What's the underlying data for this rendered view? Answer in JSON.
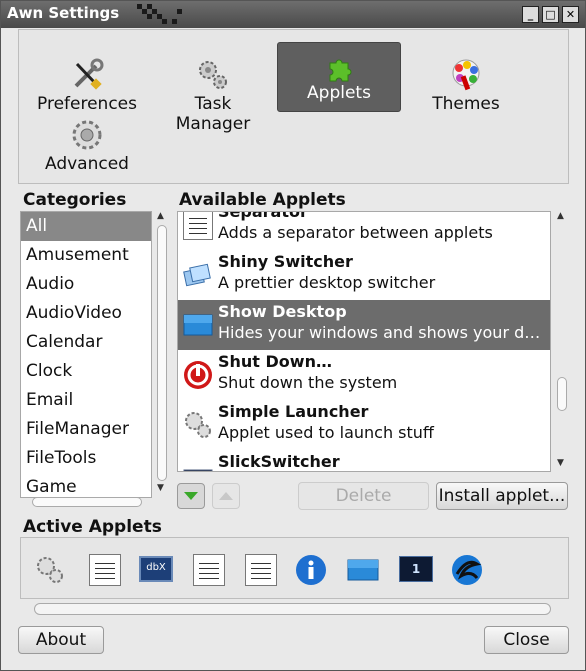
{
  "window": {
    "title": "Awn Settings",
    "minimize_symbol": "_",
    "maximize_symbol": "□",
    "close_symbol": "✕"
  },
  "toolbar": {
    "items": [
      {
        "label": "Preferences",
        "icon": "tools-icon"
      },
      {
        "label": "Task Manager",
        "icon": "gears-icon"
      },
      {
        "label": "Applets",
        "icon": "puzzle-icon",
        "active": true
      },
      {
        "label": "Themes",
        "icon": "palette-icon"
      },
      {
        "label": "Advanced",
        "icon": "gear-icon"
      }
    ]
  },
  "categories": {
    "title": "Categories",
    "items": [
      "All",
      "Amusement",
      "Audio",
      "AudioVideo",
      "Calendar",
      "Clock",
      "Email",
      "FileManager",
      "FileTools",
      "Game"
    ],
    "selected": "All"
  },
  "applets": {
    "title": "Available Applets",
    "items": [
      {
        "name": "Separator",
        "desc": "Adds a separator between applets",
        "icon": "separator-icon"
      },
      {
        "name": "Shiny Switcher",
        "desc": "A prettier desktop switcher",
        "icon": "switcher-icon"
      },
      {
        "name": "Show Desktop",
        "desc": "Hides your windows and shows your de…",
        "icon": "desktop-icon",
        "selected": true
      },
      {
        "name": "Shut Down…",
        "desc": "Shut down the system",
        "icon": "power-icon"
      },
      {
        "name": "Simple Launcher",
        "desc": "Applet used to launch stuff",
        "icon": "launcher-gear-icon"
      },
      {
        "name": "SlickSwitcher",
        "desc": "",
        "icon": "slickswitcher-icon"
      }
    ]
  },
  "buttons": {
    "delete": "Delete",
    "install": "Install applet...",
    "about": "About",
    "close": "Close"
  },
  "active_applets": {
    "title": "Active Applets",
    "items": [
      "launcher-gear-icon",
      "separator-icon",
      "dbx-icon",
      "separator-icon",
      "separator-icon",
      "info-icon",
      "desktop-icon",
      "workspace-icon",
      "swirl-icon"
    ],
    "dbx_label": "dbX",
    "workspace_label": "1"
  },
  "colors": {
    "selection": "#888888",
    "selected_row": "#6c6c6c",
    "titlebar": "#4a4a4a"
  }
}
